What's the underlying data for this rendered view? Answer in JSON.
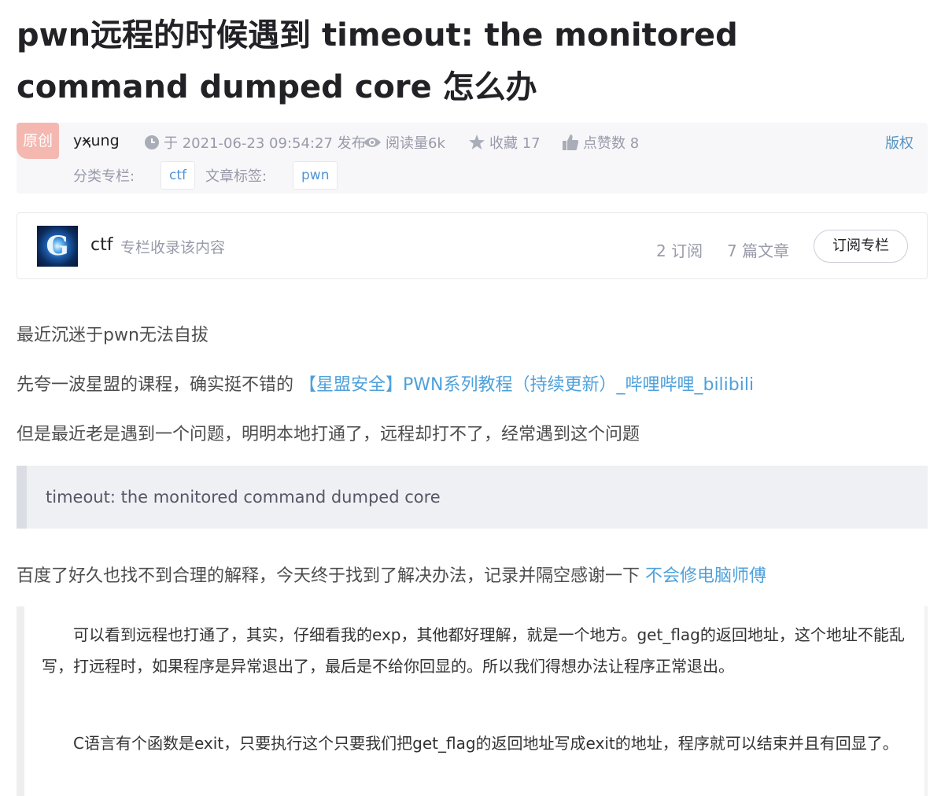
{
  "title": "pwn远程的时候遇到 timeout: the monitored command dumped core 怎么办",
  "meta": {
    "badge": "原创",
    "author": "yҳ̴ung",
    "date": "于 2021-06-23 09:54:27 发布",
    "reads": "阅读量6k",
    "favorites": "收藏 17",
    "likes": "点赞数 8",
    "copyright": "版权",
    "category_label": "分类专栏:",
    "category_tag": "ctf",
    "tags_label": "文章标签:",
    "tag": "pwn",
    "icons": [
      "clock-icon",
      "eye-icon",
      "star-icon",
      "thumb-up-icon"
    ],
    "colors": {
      "badge": "#f4b8b1",
      "link": "#4ea1db",
      "muted": "#999aaa"
    }
  },
  "column": {
    "name": "ctf",
    "desc": "专栏收录该内容",
    "subscribers": "2 订阅",
    "articles": "7 篇文章",
    "subscribe_button": "订阅专栏"
  },
  "body": {
    "p1": "最近沉迷于pwn无法自拔",
    "p2_prefix": "先夸一波星盟的课程，确实挺不错的 ",
    "p2_link": "【星盟安全】PWN系列教程（持续更新）_哔哩哔哩_bilibili",
    "p3": "但是最近老是遇到一个问题，明明本地打通了，远程却打不了，经常遇到这个问题",
    "quote": "timeout: the monitored command dumped core",
    "p4_prefix": "百度了好久也找不到合理的解释，今天终于找到了解决办法，记录并隔空感谢一下 ",
    "p4_link": "不会修电脑师傅",
    "screenshot_p1": "　　可以看到远程也打通了，其实，仔细看我的exp，其他都好理解，就是一个地方。get_flag的返回地址，这个地址不能乱写，打远程时，如果程序是异常退出了，最后是不给你回显的。所以我们得想办法让程序正常退出。",
    "screenshot_p2": "　　C语言有个函数是exit，只要执行这个只要我们把get_flag的返回地址写成exit的地址，程序就可以结束并且有回显了。"
  }
}
